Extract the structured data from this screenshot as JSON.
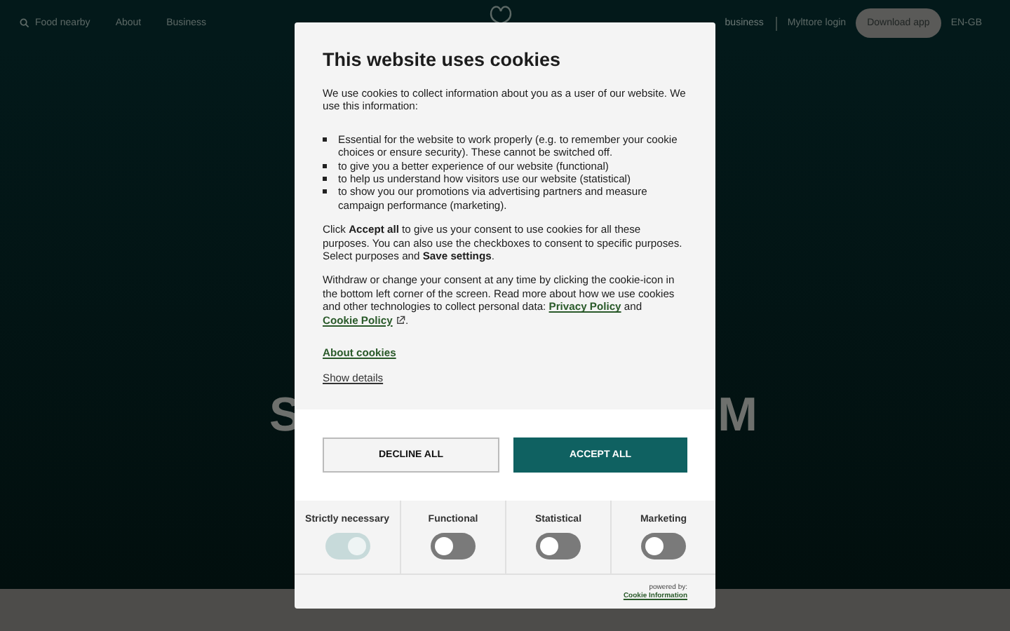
{
  "nav": {
    "left": [
      "Food nearby",
      "About",
      "Business"
    ],
    "right_partial": "business",
    "login": "Mylttore login",
    "download": "Download app",
    "language": "EN-GB"
  },
  "hero": {
    "left_fragment": "S",
    "right_fragment": "M"
  },
  "dialog": {
    "title": "This website uses cookies",
    "intro": "We use cookies to collect information about you as a user of our website. We use this information:",
    "bullets": [
      "Essential for the website to work properly (e.g. to remember your cookie choices or ensure security). These cannot be switched off.",
      "to give you a better experience of our website (functional)",
      "to help us understand how visitors use our website (statistical)",
      "to show you our promotions via advertising partners and measure campaign performance (marketing)."
    ],
    "consent": "Click **Accept all** to give us your consent to use cookies for all these purposes. You can also use the checkboxes to consent to specific purposes. Select purposes and **Save settings**.",
    "withdraw": "Withdraw or change your consent at any time by clicking the cookie-icon in the bottom left corner of the screen. Read more about how we use cookies and other technologies to collect personal data:",
    "privacy_link": "Privacy Policy",
    "and": "and",
    "cookie_link": "Cookie Policy",
    "end": ".",
    "about_link": "About cookies",
    "details_link": "Show details",
    "decline": "DECLINE ALL",
    "accept": "ACCEPT ALL",
    "categories": [
      {
        "label": "Strictly necessary",
        "checked": true,
        "disabled": true
      },
      {
        "label": "Functional",
        "checked": false,
        "disabled": false
      },
      {
        "label": "Statistical",
        "checked": false,
        "disabled": false
      },
      {
        "label": "Marketing",
        "checked": false,
        "disabled": false
      }
    ],
    "powered_by": "powered by:",
    "provider": "Cookie Information"
  }
}
